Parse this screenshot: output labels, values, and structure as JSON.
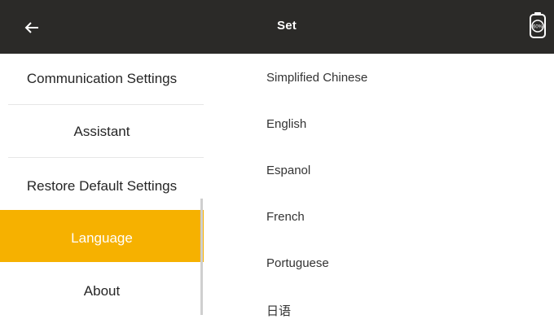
{
  "header": {
    "title": "Set",
    "battery_label": "60%",
    "back_icon": "arrow-left-icon",
    "battery_icon": "battery-icon"
  },
  "sidebar": {
    "items": [
      {
        "label": "Communication Settings"
      },
      {
        "label": "Assistant"
      },
      {
        "label": "Restore Default Settings"
      },
      {
        "label": "Language",
        "active": true
      },
      {
        "label": "About"
      }
    ]
  },
  "languages": [
    {
      "label": "Simplified Chinese"
    },
    {
      "label": "English"
    },
    {
      "label": "Espanol"
    },
    {
      "label": "French"
    },
    {
      "label": "Portuguese"
    },
    {
      "label": "日语"
    }
  ],
  "colors": {
    "header_bg": "#2b2a28",
    "accent": "#f6b100"
  }
}
